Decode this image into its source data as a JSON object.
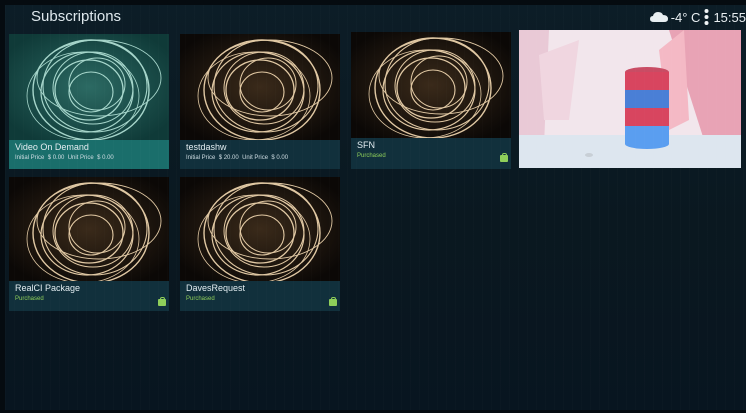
{
  "header": {
    "title": "Subscriptions",
    "weather": "-4° C",
    "time": "15:55",
    "weather_icon": "cloud-icon",
    "menu_icon": "more-vertical-icon"
  },
  "tiles": [
    {
      "name": "Video On Demand",
      "initial_label": "Initial Price",
      "initial_price": "$ 0.00",
      "unit_label": "Unit Price",
      "unit_price": "$ 0.00",
      "selected": true
    },
    {
      "name": "testdashw",
      "initial_label": "Initial Price",
      "initial_price": "$ 20.00",
      "unit_label": "Unit Price",
      "unit_price": "$ 0.00"
    },
    {
      "name": "SFN",
      "status": "Purchased"
    },
    {
      "name": "RealCI Package",
      "status": "Purchased"
    },
    {
      "name": "DavesRequest",
      "status": "Purchased"
    }
  ],
  "colors": {
    "accent_selected": "#1a6e6b",
    "caption_bg": "#11303c",
    "purchased": "#8fcf5a",
    "background": "#0a1820"
  }
}
